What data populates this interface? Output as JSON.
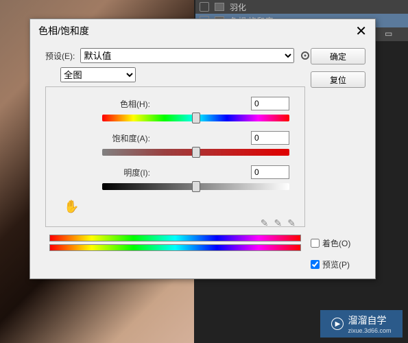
{
  "layers": {
    "items": [
      {
        "name": "羽化"
      },
      {
        "name": "色相/饱和度"
      }
    ]
  },
  "dialog": {
    "title": "色相/饱和度",
    "preset_label": "预设(E):",
    "preset_value": "默认值",
    "edit_value": "全图",
    "hue": {
      "label": "色相(H):",
      "value": "0"
    },
    "saturation": {
      "label": "饱和度(A):",
      "value": "0"
    },
    "lightness": {
      "label": "明度(I):",
      "value": "0"
    },
    "colorize_label": "着色(O)",
    "preview_label": "预览(P)",
    "ok": "确定",
    "reset": "复位"
  },
  "watermark": {
    "title": "溜溜自学",
    "url": "zixue.3d66.com"
  }
}
